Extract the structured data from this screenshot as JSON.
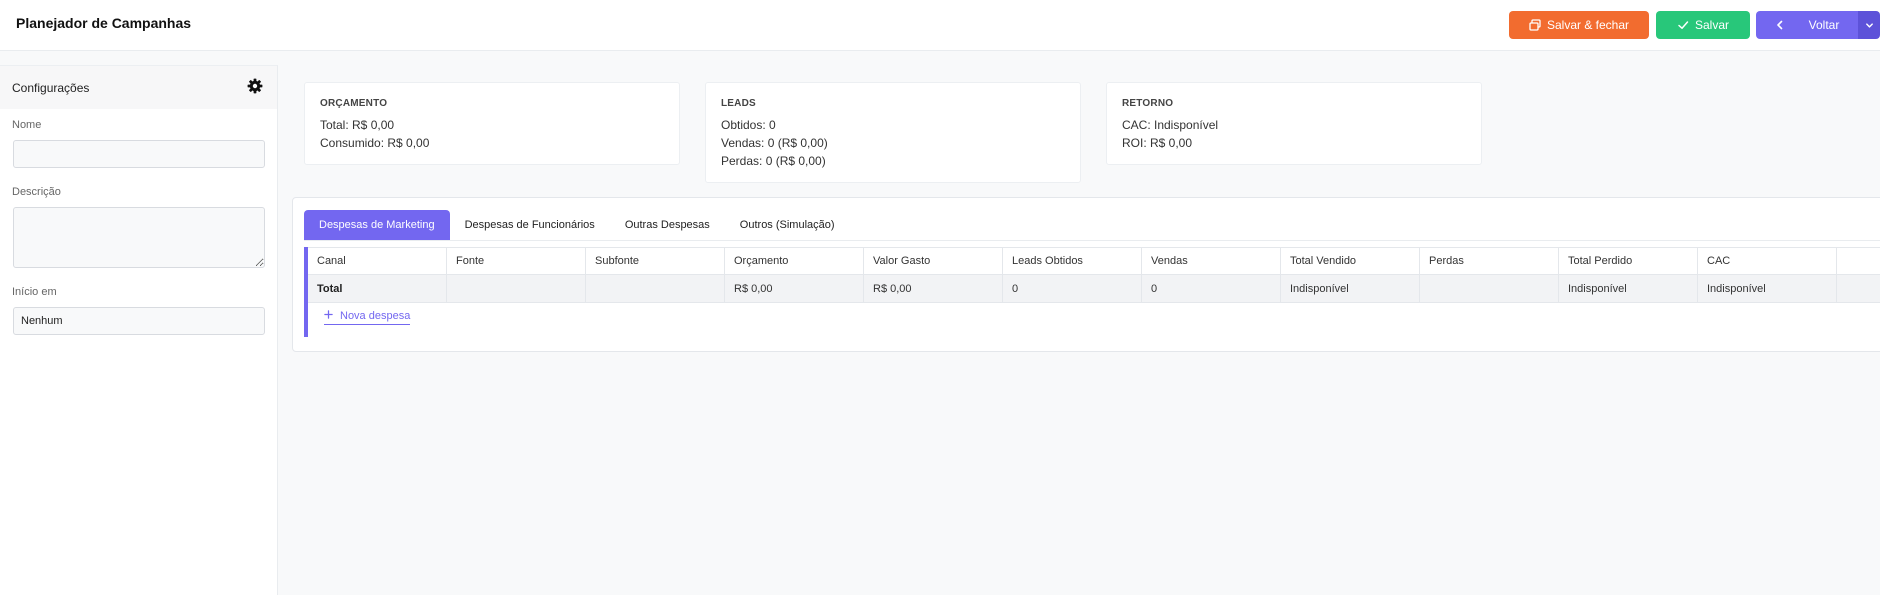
{
  "header": {
    "title": "Planejador de Campanhas",
    "save_close_label": "Salvar & fechar",
    "save_label": "Salvar",
    "back_label": "Voltar"
  },
  "sidebar": {
    "title": "Configurações",
    "fields": {
      "name_label": "Nome",
      "name_value": "",
      "description_label": "Descrição",
      "description_value": "",
      "start_label": "Início em",
      "start_value": "Nenhum"
    }
  },
  "summary": {
    "budget": {
      "title": "ORÇAMENTO",
      "lines": [
        "Total: R$ 0,00",
        "Consumido: R$ 0,00"
      ]
    },
    "leads": {
      "title": "LEADS",
      "lines": [
        "Obtidos: 0",
        "Vendas: 0 (R$ 0,00)",
        "Perdas: 0 (R$ 0,00)"
      ]
    },
    "return": {
      "title": "RETORNO",
      "lines": [
        "CAC: Indisponível",
        "ROI: R$ 0,00"
      ]
    }
  },
  "tabs": [
    {
      "label": "Despesas de Marketing",
      "active": true
    },
    {
      "label": "Despesas de Funcionários",
      "active": false
    },
    {
      "label": "Outras Despesas",
      "active": false
    },
    {
      "label": "Outros (Simulação)",
      "active": false
    }
  ],
  "table": {
    "columns": [
      "Canal",
      "Fonte",
      "Subfonte",
      "Orçamento",
      "Valor Gasto",
      "Leads Obtidos",
      "Vendas",
      "Total Vendido",
      "Perdas",
      "Total Perdido",
      "CAC",
      ""
    ],
    "total_row": [
      "Total",
      "",
      "",
      "R$ 0,00",
      "R$ 0,00",
      "0",
      "0",
      "Indisponível",
      "",
      "Indisponível",
      "Indisponível",
      ""
    ],
    "add_label": "Nova despesa"
  },
  "colors": {
    "accent": "#7367f0",
    "orange": "#f26c2f",
    "green": "#28c77a"
  },
  "icons": {
    "save_close": "save-close-icon",
    "save": "check-icon",
    "back": "chevron-left-icon",
    "dropdown": "chevron-down-icon",
    "settings": "gear-icon",
    "add": "plus-icon"
  }
}
